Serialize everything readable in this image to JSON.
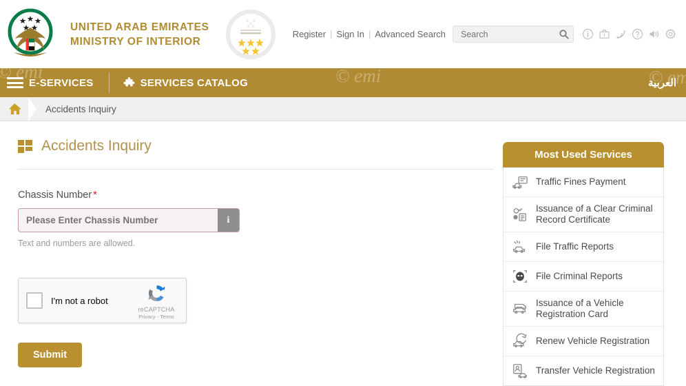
{
  "header": {
    "org_line1": "UNITED ARAB EMIRATES",
    "org_line2": "MINISTRY OF INTERIOR",
    "emblem_name": "uae-moi-emblem",
    "seal_name": "five-star-rating-seal",
    "register": "Register",
    "sign_in": "Sign In",
    "advanced_search": "Advanced Search",
    "separator": "|",
    "search_placeholder": "Search",
    "search_value": "",
    "icons": [
      "info-icon",
      "briefcase-icon",
      "rss-icon",
      "help-icon",
      "sound-icon",
      "gear-icon"
    ]
  },
  "nav": {
    "eservices": "E-SERVICES",
    "services_catalog": "SERVICES CATALOG",
    "arabic": "العربية",
    "watermark": "© emi",
    "bg_color": "#b08b34"
  },
  "breadcrumb": {
    "home": "home-icon",
    "current": "Accidents Inquiry"
  },
  "main": {
    "title": "Accidents Inquiry",
    "field_label": "Chassis Number",
    "required_mark": "*",
    "input_placeholder": "Please Enter Chassis Number",
    "input_value": "",
    "info_button": "i",
    "helper_text": "Text and numbers are allowed.",
    "submit_label": "Submit",
    "accent_color": "#b8902f"
  },
  "recaptcha": {
    "label": "I'm not a robot",
    "brand": "reCAPTCHA",
    "terms": "Privacy - Terms",
    "checked": false
  },
  "sidebar": {
    "title": "Most Used Services",
    "items": [
      {
        "label": "Traffic Fines Payment",
        "icon": "traffic-fines-icon"
      },
      {
        "label": "Issuance of a Clear Criminal Record Certificate",
        "icon": "criminal-record-certificate-icon"
      },
      {
        "label": "File Traffic Reports",
        "icon": "traffic-report-icon"
      },
      {
        "label": "File Criminal Reports",
        "icon": "criminal-report-icon"
      },
      {
        "label": "Issuance of a Vehicle Registration Card",
        "icon": "vehicle-registration-card-icon"
      },
      {
        "label": "Renew Vehicle Registration",
        "icon": "renew-registration-icon"
      },
      {
        "label": "Transfer Vehicle Registration",
        "icon": "transfer-registration-icon"
      }
    ]
  }
}
